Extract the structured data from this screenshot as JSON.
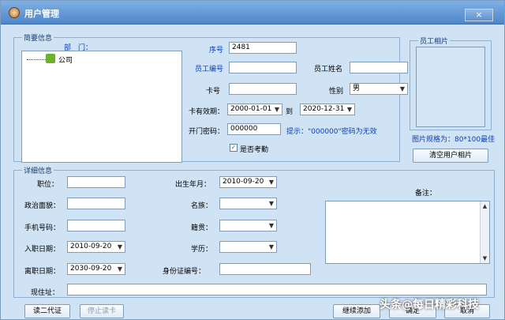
{
  "window": {
    "title": "用户管理",
    "close": "×"
  },
  "summary": {
    "legend": "简要信息",
    "department_label": "部　门：",
    "tree_root": "公司",
    "seq_label": "序号",
    "seq_value": "2481",
    "emp_no_label": "员工编号",
    "emp_name_label": "员工姓名",
    "card_label": "卡号",
    "gender_label": "性别",
    "gender_value": "男",
    "valid_label": "卡有效期：",
    "valid_from": "2000-01-01",
    "to_label": "到",
    "valid_to": "2020-12-31",
    "door_pwd_label": "开门密码：",
    "door_pwd_value": "000000",
    "hint": "提示：\"000000\"密码为无效",
    "attendance_label": "是否考勤"
  },
  "photo": {
    "legend": "员工相片",
    "spec": "图片规格为：80*100最佳",
    "clear_button": "清空用户相片"
  },
  "detail": {
    "legend": "详细信息",
    "position_label": "职位：",
    "birth_label": "出生年月：",
    "birth_value": "2010-09-20",
    "political_label": "政治面貌：",
    "nation_label": "名族：",
    "mobile_label": "手机号码：",
    "native_label": "籍贯：",
    "join_label": "入职日期：",
    "join_value": "2010-09-20",
    "education_label": "学历：",
    "leave_label": "离职日期：",
    "leave_value": "2030-09-20",
    "id_label": "身份证编号：",
    "address_label": "现住址：",
    "remark_label": "备注："
  },
  "buttons": {
    "read_id": "读二代证",
    "stop_read": "停止读卡",
    "continue_add": "继续添加",
    "ok": "确定",
    "cancel": "取消"
  },
  "watermark": "头条@每日精彩科技",
  "icons": {
    "dropdown": "chevron-down-icon",
    "close": "close-icon"
  }
}
